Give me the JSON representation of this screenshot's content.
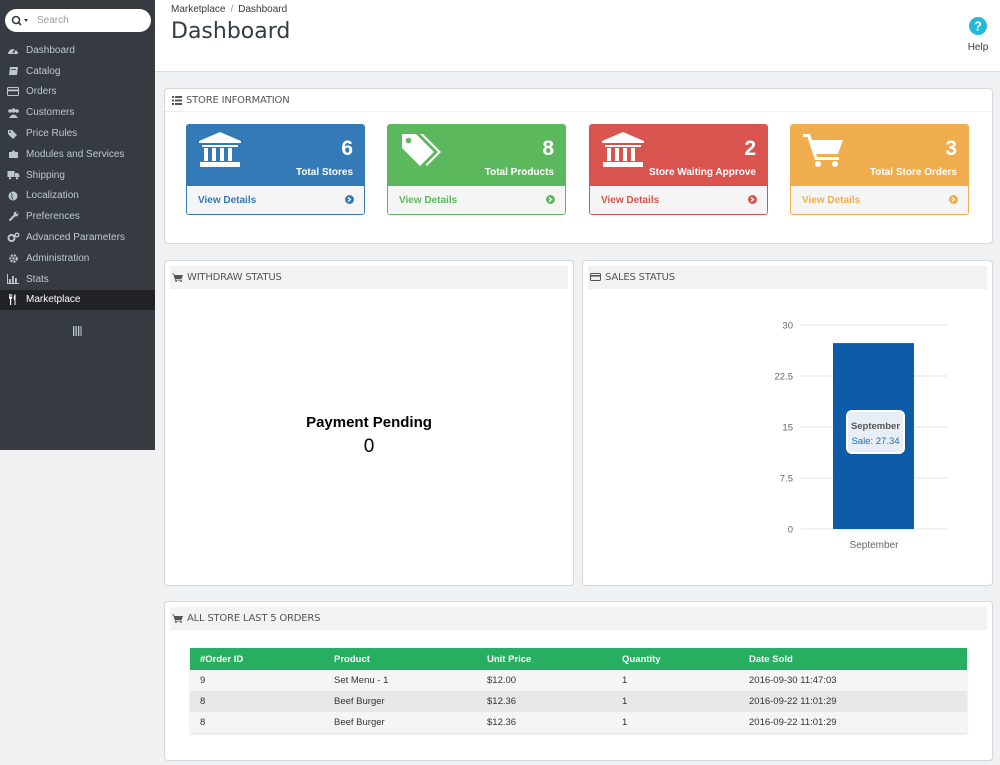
{
  "search": {
    "placeholder": "Search"
  },
  "sidebar": {
    "items": [
      {
        "label": "Dashboard",
        "icon": "dashboard-icon"
      },
      {
        "label": "Catalog",
        "icon": "book-icon"
      },
      {
        "label": "Orders",
        "icon": "credit-card-icon"
      },
      {
        "label": "Customers",
        "icon": "users-icon"
      },
      {
        "label": "Price Rules",
        "icon": "tags-icon"
      },
      {
        "label": "Modules and Services",
        "icon": "puzzle-icon"
      },
      {
        "label": "Shipping",
        "icon": "truck-icon"
      },
      {
        "label": "Localization",
        "icon": "globe-icon"
      },
      {
        "label": "Preferences",
        "icon": "wrench-icon"
      },
      {
        "label": "Advanced Parameters",
        "icon": "cogs-icon"
      },
      {
        "label": "Administration",
        "icon": "gear-icon"
      },
      {
        "label": "Stats",
        "icon": "bar-chart-icon"
      },
      {
        "label": "Marketplace",
        "icon": "cutlery-icon",
        "active": true
      }
    ]
  },
  "header": {
    "breadcrumb": [
      "Marketplace",
      "Dashboard"
    ],
    "title": "Dashboard",
    "help_label": "Help"
  },
  "store_info": {
    "title": "Store Information",
    "cards": [
      {
        "count": "6",
        "caption": "Total Stores",
        "link": "View Details",
        "color": "#337ab7",
        "icon": "bank-icon"
      },
      {
        "count": "8",
        "caption": "Total Products",
        "link": "View Details",
        "color": "#5cb85c",
        "icon": "tags-icon"
      },
      {
        "count": "2",
        "caption": "Store Waiting Approve",
        "link": "View Details",
        "color": "#d9534f",
        "icon": "bank-icon"
      },
      {
        "count": "3",
        "caption": "Total Store Orders",
        "link": "View Details",
        "color": "#f0ad4e",
        "icon": "cart-icon"
      }
    ]
  },
  "withdraw": {
    "title": "Withdraw Status",
    "label": "Payment Pending",
    "value": "0"
  },
  "sales": {
    "title": "Sales Status",
    "tooltip_title": "September",
    "tooltip_value": "Sale: 27.34"
  },
  "chart_data": {
    "type": "bar",
    "categories": [
      "September"
    ],
    "values": [
      27.34
    ],
    "ylim": [
      0,
      30
    ],
    "yticks": [
      "0",
      "7.5",
      "15",
      "22.5",
      "30"
    ],
    "grid": true,
    "color": "#0e5ca8"
  },
  "orders": {
    "title": "All Store Last 5 Orders",
    "columns": [
      "#Order ID",
      "Product",
      "Unit Price",
      "Quantity",
      "Date Sold"
    ],
    "rows": [
      [
        "9",
        "Set Menu - 1",
        "$12.00",
        "1",
        "2016-09-30 11:47:03"
      ],
      [
        "8",
        "Beef Burger",
        "$12.36",
        "1",
        "2016-09-22 11:01:29"
      ],
      [
        "8",
        "Beef Burger",
        "$12.36",
        "1",
        "2016-09-22 11:01:29"
      ]
    ]
  }
}
